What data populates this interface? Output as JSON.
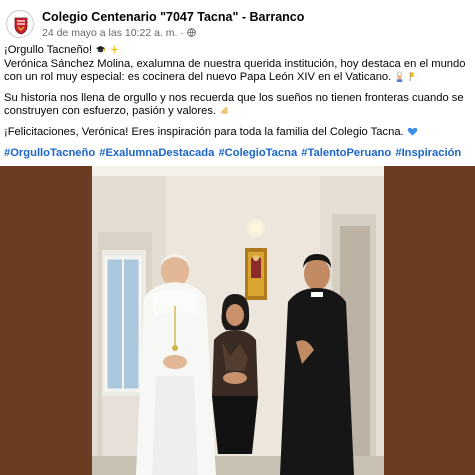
{
  "post": {
    "author": "Colegio Centenario \"7047 Tacna\" - Barranco",
    "timestamp": "24 de mayo a las 10:22 a. m.",
    "separator": "·",
    "privacy_icon": "globe-icon",
    "paragraphs": [
      "¡Orgullo Tacneño!",
      "Verónica Sánchez Molina, exalumna de nuestra querida institución, hoy destaca en el mundo con un rol muy especial: es cocinera del nuevo Papa León XIV en el Vaticano.",
      "Su historia nos llena de orgullo y nos recuerda que los sueños no tienen fronteras cuando se construyen con esfuerzo, pasión y valores.",
      "¡Felicitaciones, Verónica! Eres inspiración para toda la familia del Colegio Tacna."
    ],
    "hashtags": [
      "#OrgulloTacneño",
      "#ExalumnaDestacada",
      "#ColegioTacna",
      "#TalentoPeruano",
      "#Inspiración"
    ],
    "colors": {
      "hashtag": "#1b65c9",
      "meta": "#65676b",
      "photo_frame": "#6b3b22"
    }
  }
}
